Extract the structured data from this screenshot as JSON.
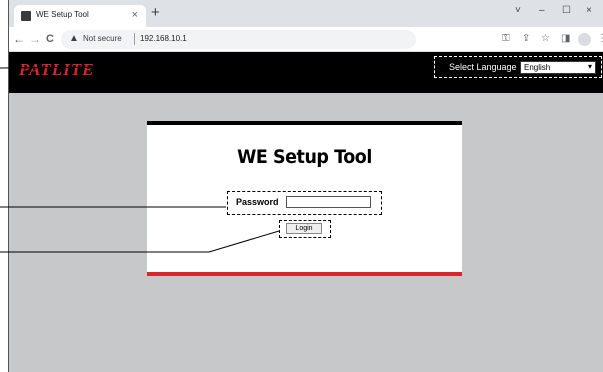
{
  "browser": {
    "tab_title": "WE Setup Tool",
    "tab_close": "×",
    "new_tab": "+",
    "window_controls": [
      "˅",
      "–",
      "☐",
      "×"
    ],
    "nav": {
      "back": "←",
      "forward": "→",
      "reload": "C"
    },
    "security_label": "Not secure",
    "url": "192.168.10.1",
    "toolbar_icons": [
      "key-icon",
      "share-icon",
      "star-icon",
      "sidepanel-icon",
      "profile-icon",
      "menu-icon"
    ]
  },
  "page": {
    "brand": "PATLITE",
    "language": {
      "label": "Select Language",
      "selected": "English"
    },
    "title": "WE Setup Tool",
    "password_label": "Password",
    "password_value": "",
    "login_label": "Login"
  },
  "colors": {
    "brand_red": "#d8262e",
    "page_bg": "#c7c8ca",
    "header_bg": "#000000"
  }
}
